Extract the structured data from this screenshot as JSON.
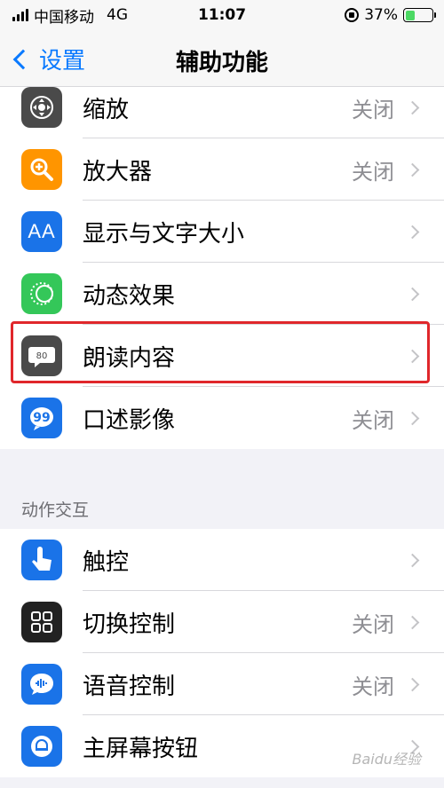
{
  "status_bar": {
    "carrier": "中国移动",
    "network": "4G",
    "time": "11:07",
    "battery_percent": "37%",
    "battery_level": 0.37
  },
  "nav": {
    "back_label": "设置",
    "title": "辅助功能"
  },
  "vision_group": [
    {
      "label": "缩放",
      "value": "关闭",
      "icon": "zoom-icon",
      "color": "#4a4a4a"
    },
    {
      "label": "放大器",
      "value": "关闭",
      "icon": "magnifier-icon",
      "color": "#ff9500"
    },
    {
      "label": "显示与文字大小",
      "value": "",
      "icon": "text-size-icon",
      "color": "#1a73e8"
    },
    {
      "label": "动态效果",
      "value": "",
      "icon": "motion-icon",
      "color": "#34c759"
    },
    {
      "label": "朗读内容",
      "value": "",
      "icon": "spoken-content-icon",
      "color": "#4a4a4a"
    },
    {
      "label": "口述影像",
      "value": "关闭",
      "icon": "audio-description-icon",
      "color": "#1a73e8"
    }
  ],
  "section_header": "动作交互",
  "interaction_group": [
    {
      "label": "触控",
      "value": "",
      "icon": "touch-icon",
      "color": "#1a73e8"
    },
    {
      "label": "切换控制",
      "value": "关闭",
      "icon": "switch-control-icon",
      "color": "#222222"
    },
    {
      "label": "语音控制",
      "value": "关闭",
      "icon": "voice-control-icon",
      "color": "#1a73e8"
    },
    {
      "label": "主屏幕按钮",
      "value": "",
      "icon": "home-button-icon",
      "color": "#1a73e8"
    }
  ],
  "watermark": "Baidu经验"
}
